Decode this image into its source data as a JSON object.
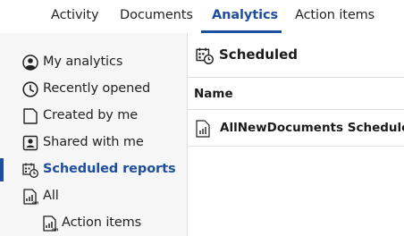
{
  "tabs": [
    {
      "label": "Activity",
      "active": false
    },
    {
      "label": "Documents",
      "active": false
    },
    {
      "label": "Analytics",
      "active": true
    },
    {
      "label": "Action items",
      "active": false
    }
  ],
  "sidebar": {
    "items": [
      {
        "label": "My analytics",
        "icon": "user-circle-icon"
      },
      {
        "label": "Recently opened",
        "icon": "clock-icon"
      },
      {
        "label": "Created by me",
        "icon": "document-icon"
      },
      {
        "label": "Shared with me",
        "icon": "shared-user-icon"
      },
      {
        "label": "Scheduled reports",
        "icon": "calendar-clock-icon",
        "active": true
      },
      {
        "label": "All",
        "icon": "report-chart-icon"
      },
      {
        "label": "Action items",
        "icon": "report-chart-icon"
      }
    ]
  },
  "main": {
    "title": "Scheduled",
    "title_icon": "calendar-clock-icon",
    "column_header": "Name",
    "rows": [
      {
        "name": "AllNewDocuments Schedule",
        "icon": "report-chart-icon"
      }
    ]
  },
  "colors": {
    "accent": "#1e4f9e",
    "sidebar_bg": "#f6f6f6",
    "divider": "#dedede"
  }
}
